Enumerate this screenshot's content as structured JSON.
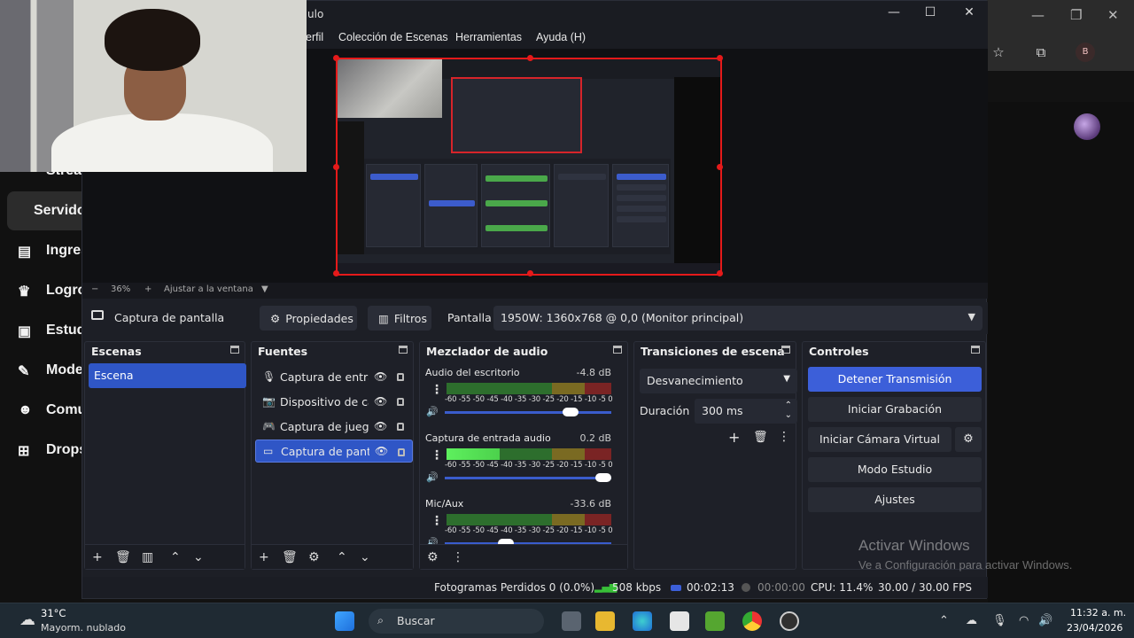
{
  "background_app": {
    "nav_items": [
      "Strea",
      "Servido",
      "Ingres",
      "Logro",
      "Estud",
      "Mode",
      "Comu",
      "Drops"
    ],
    "avatar_letter": "B"
  },
  "obs": {
    "title_fragment": "ulo",
    "menu": [
      "erfil",
      "Colección de Escenas",
      "Herramientas",
      "Ayuda (H)"
    ],
    "zoom": {
      "minus": "−",
      "value": "36%",
      "plus": "+",
      "fit": "Ajustar a la ventana"
    },
    "source_toolbar": {
      "selected_source": "Captura de pantalla",
      "properties": "Propiedades",
      "filters": "Filtros",
      "display_label": "Pantalla",
      "display_value": "1950W: 1360x768 @ 0,0 (Monitor principal)"
    },
    "docks": {
      "scenes": {
        "title": "Escenas",
        "items": [
          "Escena"
        ]
      },
      "sources": {
        "title": "Fuentes",
        "items": [
          "Captura de entrada audio",
          "Dispositivo de captura",
          "Captura de juego",
          "Captura de pantalla"
        ]
      },
      "mixer": {
        "title": "Mezclador de audio",
        "scale": "-60 -55 -50 -45 -40 -35 -30 -25 -20 -15 -10 -5 0",
        "channels": [
          {
            "name": "Audio del escritorio",
            "db": "-4.8 dB",
            "level": 0.0,
            "volume": 0.78
          },
          {
            "name": "Captura de entrada audio",
            "db": "0.2 dB",
            "level": 0.32,
            "volume": 1.0
          },
          {
            "name": "Mic/Aux",
            "db": "-33.6 dB",
            "level": 0.0,
            "volume": 0.35
          }
        ]
      },
      "transitions": {
        "title": "Transiciones de escena",
        "selected": "Desvanecimiento",
        "duration_label": "Duración",
        "duration_value": "300 ms"
      },
      "controls": {
        "title": "Controles",
        "buttons": [
          "Detener Transmisión",
          "Iniciar Grabación",
          "Iniciar Cámara Virtual",
          "Modo Estudio",
          "Ajustes"
        ]
      }
    },
    "status": {
      "dropped": "Fotogramas Perdidos 0 (0.0%)",
      "bitrate": "508 kbps",
      "stream_time": "00:02:13",
      "rec_time": "00:00:00",
      "cpu": "CPU: 11.4%",
      "fps": "30.00 / 30.00 FPS"
    }
  },
  "watermark": {
    "line1": "Activar Windows",
    "line2": "Ve a Configuración para activar Windows."
  },
  "taskbar": {
    "weather_temp": "31°C",
    "weather_desc": "Mayorm. nublado",
    "search": "Buscar",
    "time": "11:32 a. m.",
    "date": "23/04/2026"
  },
  "colors": {
    "accent": "#3c5fd9",
    "preview_border": "#e51a1a",
    "selected": "#2f56c6"
  }
}
